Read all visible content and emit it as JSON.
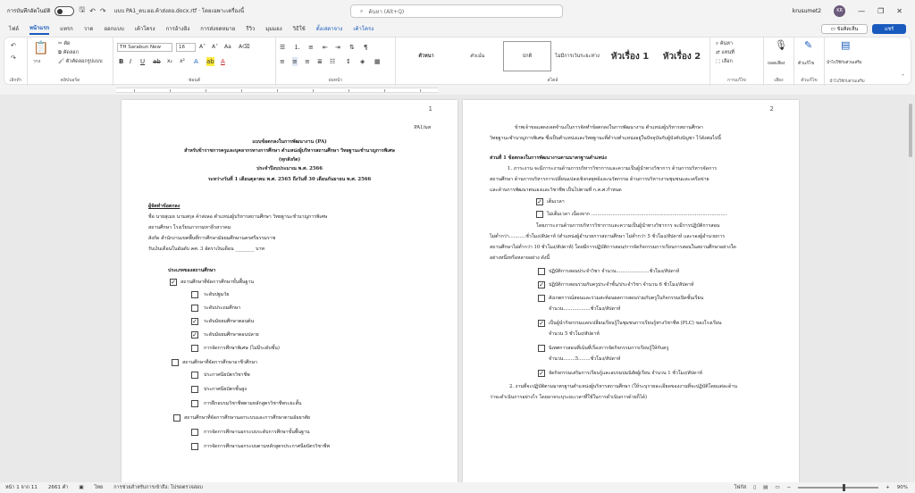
{
  "titlebar": {
    "autosave_label": "การบันทึกอัตโนมัติ",
    "doc_title": "แบบ PA1_ตบ.ผอ.ค้าส่งลอ.docx.rtf · โดยเฉพาะเครื่องนี้",
    "search_placeholder": "ค้นหา (Alt+Q)",
    "user": "krusumet2",
    "avatar_initials": "KR"
  },
  "tabs": [
    "ไฟล์",
    "หน้าแรก",
    "แทรก",
    "วาด",
    "ออกแบบ",
    "เค้าโครง",
    "การอ้างอิง",
    "การส่งจดหมาย",
    "รีวิว",
    "มุมมอง",
    "วิธีใช้",
    "ตั้งเล่ตาจาง",
    "เค้าโครง"
  ],
  "comments_label": "ข้อคิดเห็น",
  "share_label": "แชร์",
  "ribbon": {
    "paste_label": "วาง",
    "clipboard_label": "คลิปบอร์ด",
    "undo_label": "เลิกทำ",
    "cut_label": "ตัด",
    "copy_label": "คัดลอก",
    "format_painter_label": "ตัวคัดลอกรูปแบบ",
    "font_name": "TH Sarabun New",
    "font_size": "16",
    "font_group": "ฟอนต์",
    "paragraph_group": "ย่อหน้า",
    "styles": [
      "ตัวหนา",
      "ตัวเน้น",
      "ปกติ",
      "ไม่มีการเว้นระยะห่าง",
      "หัวเรื่อง 1",
      "หัวเรื่อง 2"
    ],
    "styles_group": "สไตล์",
    "find_label": "ค้นหา",
    "replace_label": "แทนที่",
    "select_label": "เลือก",
    "editing_group": "การแก้ไข",
    "dictate_label": "ถอดเสียง",
    "voice_group": "เสียง",
    "editor_label": "ตัวแก้ไข",
    "editor_group": "ตัวแก้ไข",
    "addins_label": "นำไปใช้กับส่วนเสริม",
    "addins_group": "นำไปใช้กับส่วนเสริม"
  },
  "page1": {
    "number": "1",
    "code": "PA1/มส",
    "heading1": "แบบข้อตกลงในการพัฒนางาน (PA)",
    "heading2": "สำหรับข้าราชการครูและบุคลากรทางการศึกษา ตำแหน่งผู้บริหารสถานศึกษา วิทยฐานะชำนาญการพิเศษ",
    "heading3": "(ทุกสังกัด)",
    "heading4": "ประจำปีงบประมาณ พ.ศ. 2566",
    "heading5": "ระหว่างวันที่ 1 เดือนตุลาคม พ.ศ. 2565 ถึงวันที่ 30 เดือนกันยายน พ.ศ. 2566",
    "party_heading": "ผู้จัดทำข้อตกลง",
    "name_line": "ชื่อ นายสุเมธ นามสกุล ค้าส่งลอ ตำแหน่งผู้บริหารสถานศึกษา วิทยฐานะชำนาญการพิเศษ",
    "school_line": "สถานศึกษา โรงเรียนภากรมหาธีรสวาคม",
    "office_line": "สังกัด สำนักงานเขตพื้นที่การศึกษามัธยมศึกษานครศรีธรรมราช",
    "salary_line": "รับเงินเดือนในอันดับ คศ. 3 อัตราเงินเดือน ________ บาท",
    "type_heading": "ประเภทของสถานศึกษา",
    "items": [
      {
        "label": "สถานศึกษาที่จัดการศึกษาขั้นพื้นฐาน",
        "checked": true,
        "level": 0
      },
      {
        "label": "ระดับปฐมวัย",
        "checked": false,
        "level": 1
      },
      {
        "label": "ระดับประถมศึกษา",
        "checked": false,
        "level": 1
      },
      {
        "label": "ระดับมัธยมศึกษาตอนต้น",
        "checked": true,
        "level": 1
      },
      {
        "label": "ระดับมัธยมศึกษาตอนปลาย",
        "checked": true,
        "level": 1
      },
      {
        "label": "การจัดการศึกษาพิเศษ (ไม่มีระดับชั้น)",
        "checked": false,
        "level": 1
      },
      {
        "label": "สถานศึกษาที่จัดการศึกษาอาชีวศึกษา",
        "checked": false,
        "level": 0
      },
      {
        "label": "ประกาศนียบัตรวิชาชีพ",
        "checked": false,
        "level": 1
      },
      {
        "label": "ประกาศนียบัตรชั้นสูง",
        "checked": false,
        "level": 1
      },
      {
        "label": "การฝึกอบรมวิชาชีพตามหลักสูตรวิชาชีพระยะสั้น",
        "checked": false,
        "level": 1
      },
      {
        "label": "สถานศึกษาที่จัดการศึกษานอกระบบและการศึกษาตามอัธยาศัย",
        "checked": false,
        "level": 0
      },
      {
        "label": "การจัดการศึกษานอกระบบระดับการศึกษาขั้นพื้นฐาน",
        "checked": false,
        "level": 1
      },
      {
        "label": "การจัดการศึกษานอกระบบตามหลักสูตรประกาศนียบัตรวิชาชีพ",
        "checked": false,
        "level": 1
      }
    ]
  },
  "page2": {
    "number": "2",
    "intro1": "ข้าพเจ้าขอแสดงเจตจำนงในการจัดทำข้อตกลงในการพัฒนางาน ตำแหน่งผู้บริหารสถานศึกษา",
    "intro2": "วิทยฐานะชำนาญการพิเศษ ซึ่งเป็นตำแหน่งและวิทยฐานะที่ดำรงตำแหน่งอยู่ในปัจจุบันกับผู้บังคับบัญชา ไว้ดังต่อไปนี้",
    "section1": "ส่วนที่ 1 ข้อตกลงในการพัฒนางานตามมาตรฐานตำแหน่ง",
    "p1": "1. ภาระงาน จะมีภาระงานด้านการบริหารวิชาการและความเป็นผู้นำทางวิชาการ ด้านการบริหารจัดการ",
    "p2": "สถานศึกษา ด้านการบริหารการเปลี่ยนแปลงเชิงกลยุทธ์และนวัตกรรม ด้านการบริหารงานชุมชนและเครือข่าย",
    "p3": "และด้านการพัฒนาตนเองและวิชาชีพ เป็นไปตามที่ ก.ค.ศ.กำหนด",
    "opt_full": "เต็มเวลา",
    "opt_partial": "ไม่เต็มเวลา เนื่องจาก ..........................................................................................",
    "p4": "โดยภาระงานด้านการบริหารวิชาการและความเป็นผู้นำทางวิชาการ จะมีการปฏิบัติการสอน",
    "p5": "ไม่ต่ำกว่า...........ชั่วโมง/สัปดาห์ (ตำแหน่งผู้อำนวยการสถานศึกษา ไม่ต่ำกว่า 5 ชั่วโมง/สัปดาห์ และรองผู้อำนวยการ",
    "p6": "สถานศึกษาไม่ต่ำกว่า 10 ชั่วโมง/สัปดาห์) โดยมีการปฏิบัติการสอน/การจัดกิจกรรมการเรียนการสอนในสถานศึกษาอย่างใด",
    "p7": "อย่างหนึ่งหรือหลายอย่าง ดังนี้",
    "tasks": [
      {
        "label": "ปฏิบัติการสอนประจำวิชา จำนวน......................ชั่วโมง/สัปดาห์",
        "checked": false
      },
      {
        "label": "ปฏิบัติการสอนร่วมกับครูประจำชั้น/ประจำวิชา จำนวน 6 ชั่วโมง/สัปดาห์",
        "checked": true
      },
      {
        "label": "สังเกตการณ์สอนและร่วมสะท้อนผลการสอนร่วมกับครูในกิจกรรมเปิดชั้นเรียน",
        "checked": false
      },
      {
        "label": "เป็นผู้นำกิจกรรมแลกเปลี่ยนเรียนรู้ในชุมชนการเรียนรู้ทางวิชาชีพ (PLC) ของโรงเรียน",
        "checked": true
      },
      {
        "label": "นิเทศการสอนที่เน้นที่เรื่องการจัดกิจกรรมการเรียนรู้ให้กับครู",
        "checked": false
      },
      {
        "label": "จัดกิจกรรมเสริมการเรียนรู้และอบรมบ่มนิสัยผู้เรียน จำนวน 1 ชั่วโมง/สัปดาห์",
        "checked": true
      }
    ],
    "task3_amount": "จำนวน..................ชั่วโมง/สัปดาห์",
    "task4_amount": "จำนวน 5 ชั่วโมง/สัปดาห์",
    "task5_amount": "จำนวน........5........ชั่วโมง/สัปดาห์",
    "p8": "2. งานที่จะปฏิบัติตามมาตรฐานตำแหน่งผู้บริหารสถานศึกษา (ให้ระบุรายละเอียดของงานที่จะปฏิบัติโดยแต่ละด้าน",
    "p9": "ว่าจะดำเนินการอย่างไร โดยอาจระบุระยะเวลาที่ใช้ในการดำเนินการด้วยก็ได้)"
  },
  "status": {
    "page": "หน้า 1 จาก 11",
    "words": "2661 คำ",
    "lang": "ไทย",
    "accessibility": "การช่วยสำหรับการเข้าถึง: โปรดตรวจสอบ",
    "focus": "โฟกัส",
    "zoom": "90%"
  }
}
